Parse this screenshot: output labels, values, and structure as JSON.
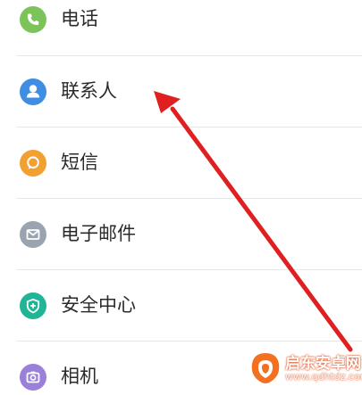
{
  "settings_list": {
    "items": [
      {
        "label": "电话",
        "icon": "phone-icon",
        "color": "#7cc35a"
      },
      {
        "label": "联系人",
        "icon": "contacts-icon",
        "color": "#3f8ee3"
      },
      {
        "label": "短信",
        "icon": "message-icon",
        "color": "#f2a032"
      },
      {
        "label": "电子邮件",
        "icon": "mail-icon",
        "color": "#9aa3b0"
      },
      {
        "label": "安全中心",
        "icon": "shield-icon",
        "color": "#20b596"
      },
      {
        "label": "相机",
        "icon": "camera-icon",
        "color": "#9a80d8"
      }
    ]
  },
  "annotation": {
    "arrow_color": "#e02020",
    "arrow_target": "联系人"
  },
  "watermark": {
    "title": "启东安卓网",
    "url": "www.qdhtdz.com",
    "color": "#f37021"
  }
}
